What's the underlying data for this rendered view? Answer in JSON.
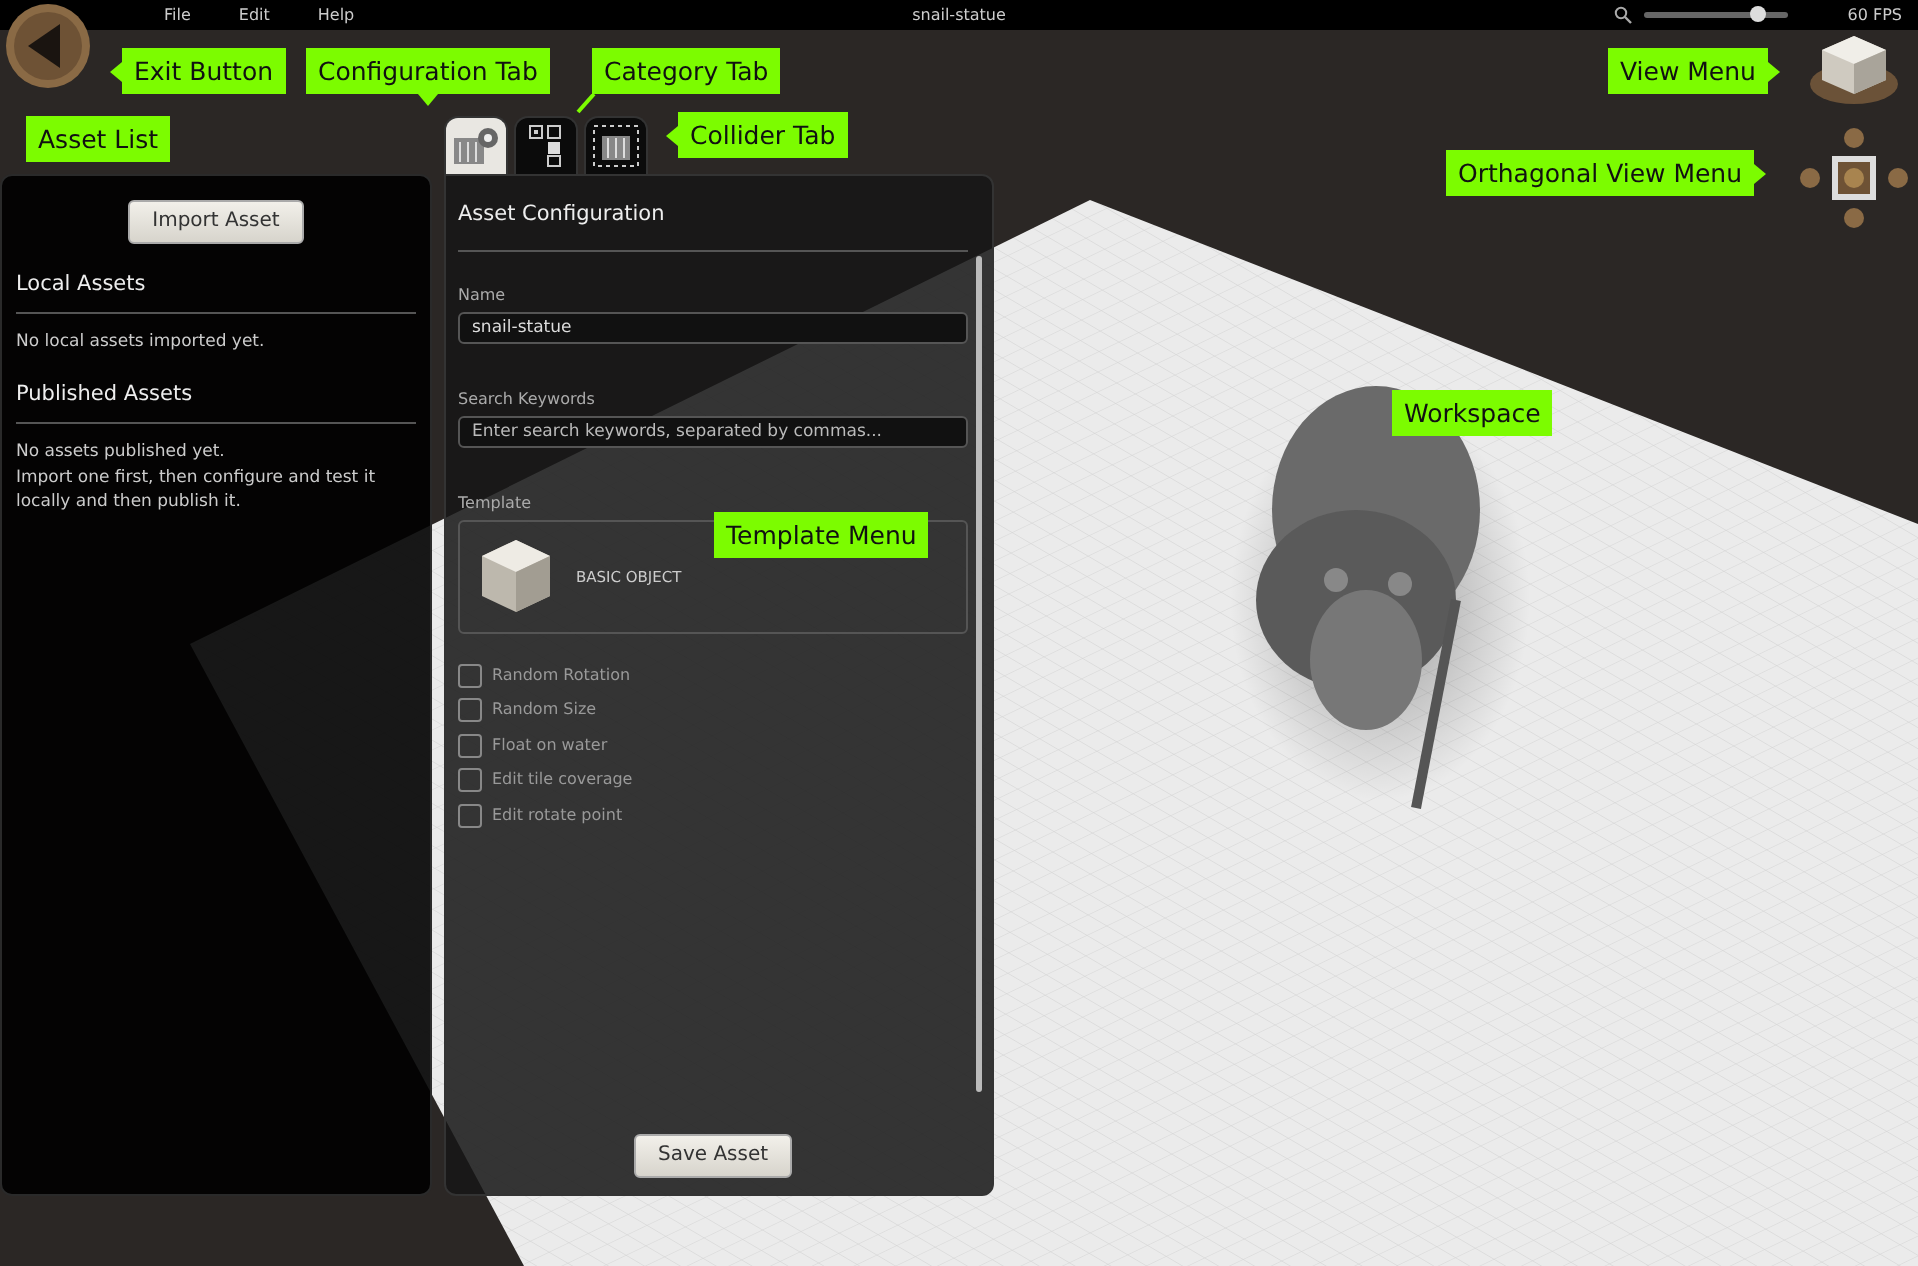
{
  "menu_bar": {
    "menus": [
      "File",
      "Edit",
      "Help"
    ],
    "title": "snail-statue",
    "zoom_slider": {
      "level": 0.8
    },
    "fps": "60 FPS"
  },
  "asset_list": {
    "import_button": "Import Asset",
    "sections": [
      {
        "title": "Local Assets",
        "lines": [
          "No local assets imported yet."
        ]
      },
      {
        "title": "Published Assets",
        "lines": [
          "No assets published yet.",
          "Import one first, then configure and test it locally and then publish it."
        ]
      }
    ]
  },
  "tabs": [
    {
      "kind": "configuration",
      "selected": true
    },
    {
      "kind": "category",
      "selected": false
    },
    {
      "kind": "collider",
      "selected": false
    }
  ],
  "config": {
    "title": "Asset Configuration",
    "name": {
      "label": "Name",
      "value": "snail-statue"
    },
    "keywords": {
      "label": "Search Keywords",
      "placeholder": "Enter search keywords, separated by commas..."
    },
    "template": {
      "label": "Template",
      "value": "BASIC OBJECT"
    },
    "options": [
      {
        "label": "Random Rotation",
        "checked": false
      },
      {
        "label": "Random Size",
        "checked": false
      },
      {
        "label": "Float on water",
        "checked": false
      },
      {
        "label": "Edit tile coverage",
        "checked": false
      },
      {
        "label": "Edit rotate point",
        "checked": false
      }
    ],
    "save_button": "Save Asset"
  },
  "annotations": [
    {
      "text": "Exit Button",
      "kind": "left"
    },
    {
      "text": "Configuration Tab",
      "kind": "down"
    },
    {
      "text": "Category Tab",
      "kind": "line"
    },
    {
      "text": "Collider Tab",
      "kind": "left"
    },
    {
      "text": "Asset List",
      "kind": "plain"
    },
    {
      "text": "View Menu",
      "kind": "right"
    },
    {
      "text": "Orthagonal View Menu",
      "kind": "right"
    },
    {
      "text": "Workspace",
      "kind": "plain"
    },
    {
      "text": "Template Menu",
      "kind": "plain"
    }
  ]
}
